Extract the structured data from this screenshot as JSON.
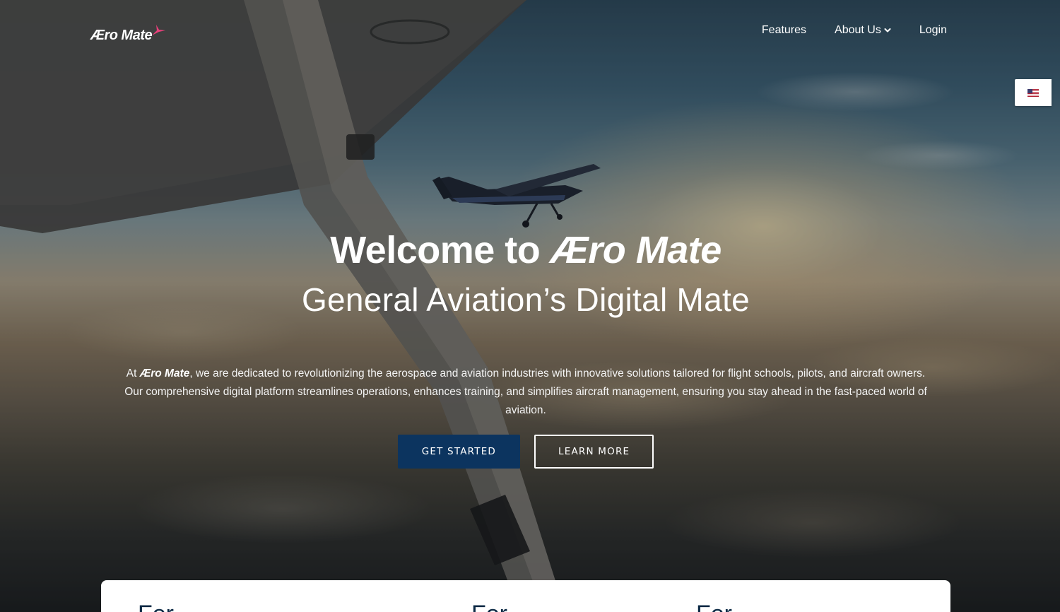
{
  "header": {
    "logo_text": "Æro Mate",
    "nav": {
      "features": "Features",
      "about_us": "About Us",
      "login": "Login"
    },
    "language_flag": "us-flag-icon"
  },
  "hero": {
    "title_prefix": "Welcome to ",
    "title_brand": "Æro Mate",
    "subtitle": "General Aviation’s Digital Mate",
    "description_prefix": "At ",
    "description_brand": "Æro Mate",
    "description_line1": ", we are dedicated to revolutionizing the aerospace and aviation industries with innovative solutions tailored for flight schools, pilots, and aircraft owners.",
    "description_line2": "Our comprehensive digital platform streamlines operations, enhances training, and simplifies aircraft management, ensuring you stay ahead in the fast-paced world of aviation.",
    "primary_button": "GET STARTED",
    "secondary_button": "LEARN MORE"
  },
  "feature_card": {
    "headings": [
      "For ",
      "For ",
      "For "
    ]
  },
  "colors": {
    "primary_button": "#0c345f",
    "logo_accent": "#e8407a",
    "heading_text": "#0c2a45"
  }
}
